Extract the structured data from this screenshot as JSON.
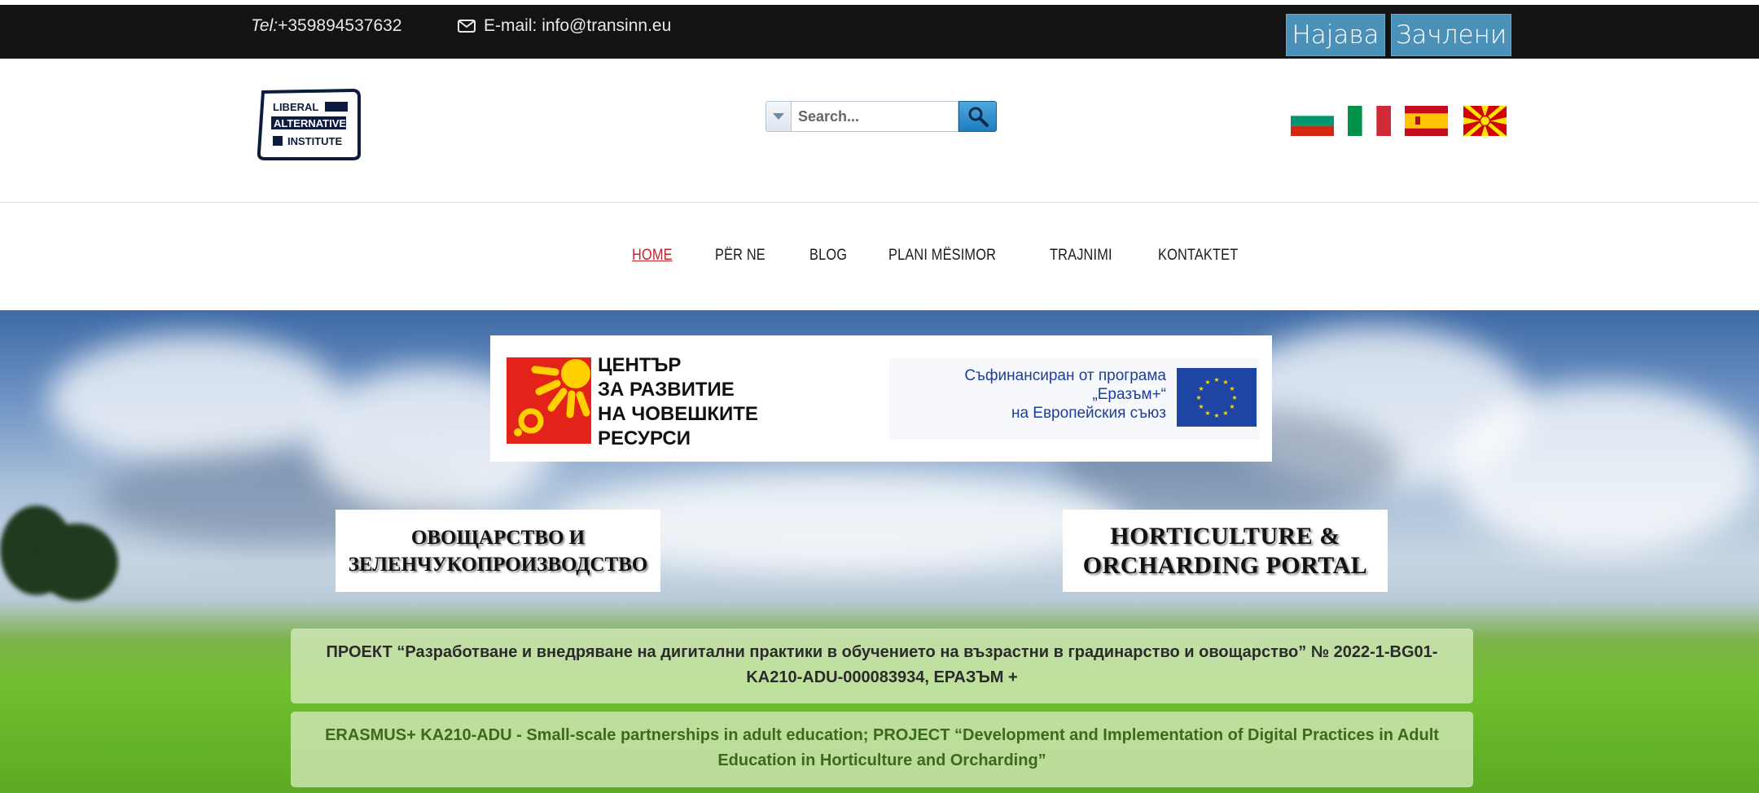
{
  "topbar": {
    "tel_label": "Tel:",
    "tel_value": "+359894537632",
    "email_label": "E-mail:",
    "email_value": "info@transinn.eu",
    "login_label": "Најава",
    "register_label": "Зачлени",
    "button_color": "#4a90b8"
  },
  "header": {
    "logo": {
      "line1": "LIBERAL",
      "line2": "ALTERNATIVE",
      "line3": "INSTITUTE"
    },
    "search": {
      "placeholder": "Search..."
    },
    "flags": [
      "bulgaria-flag-icon",
      "italy-flag-icon",
      "spain-flag-icon",
      "north-macedonia-flag-icon"
    ]
  },
  "nav": {
    "items": [
      {
        "label": "HOME",
        "active": true
      },
      {
        "label": "PËR NE",
        "active": false
      },
      {
        "label": "BLOG",
        "active": false
      },
      {
        "label": "PLANI MËSIMOR",
        "active": false
      },
      {
        "label": "TRAJNIMI",
        "active": false
      },
      {
        "label": "KONTAKTET",
        "active": false
      }
    ],
    "active_color": "#c0272d"
  },
  "hero": {
    "banner": {
      "hrc_lines": [
        "ЦЕНТЪР",
        "ЗА РАЗВИТИЕ",
        "НА ЧОВЕШКИТЕ",
        "РЕСУРСИ"
      ],
      "eu_lines": [
        "Съфинансиран от програма",
        "„Еразъм+“",
        "на Европейския съюз"
      ]
    },
    "title_bg_lines": [
      "ОВОЩАРСТВО И",
      "ЗЕЛЕНЧУКОПРОИЗВОДСТВО"
    ],
    "title_en_lines": [
      "HORTICULTURE &",
      "ORCHARDING PORTAL"
    ],
    "project_bg": "ПРОЕКТ “Разработване и внедряване на дигитални практики в обучението на възрастни в градинарство и овощарство” № 2022-1-BG01-KA210-ADU-000083934, ЕРАЗЪМ +",
    "project_en": "ERASMUS+ KA210-ADU - Small-scale partnerships in adult education; PROJECT “Development and Implementation of Digital Practices in Adult Education in Horticulture and Orcharding”"
  }
}
